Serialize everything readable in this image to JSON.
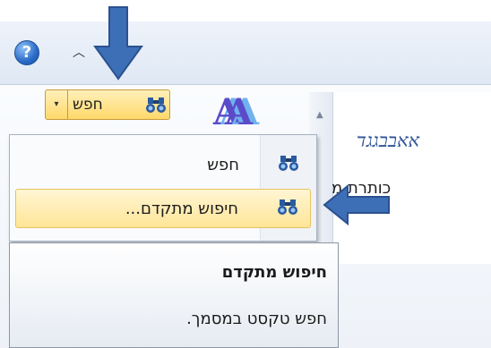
{
  "window": {
    "help_glyph": "?",
    "collapse_glyph": "︿"
  },
  "ribbon": {
    "find_button": {
      "label": "חפש",
      "dropdown_glyph": "▾",
      "icon": "binoculars-icon"
    },
    "styles_glyph": "A",
    "gallery": {
      "scroll_up_glyph": "▲",
      "style_sample_1": "אאבבגגד",
      "style_sample_2": "כותרת מ"
    }
  },
  "find_menu": {
    "items": [
      {
        "label": "חפש",
        "icon": "binoculars-icon",
        "highlighted": false
      },
      {
        "label": "חיפוש מתקדם...",
        "icon": "binoculars-icon",
        "highlighted": true
      }
    ]
  },
  "tooltip": {
    "title": "חיפוש מתקדם",
    "description": "חפש טקסט במסמך."
  },
  "annotations": {
    "arrow_color": "#3d6fb6"
  }
}
